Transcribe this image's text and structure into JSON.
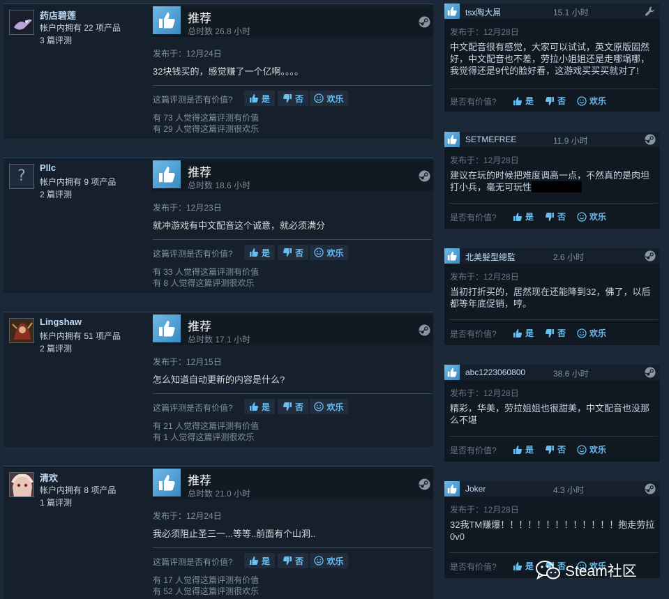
{
  "ui": {
    "recommended": "推荐",
    "posted_prefix": "发布于：",
    "helpful_question": "这篇评测是否有价值?",
    "yes": "是",
    "no": "否",
    "funny": "欢乐",
    "mini_helpful_question": "是否有价值?"
  },
  "reviews": [
    {
      "author": "药店碧莲",
      "products": "帐户内拥有 22 项产品",
      "reviews_count": "3 篇评测",
      "hours": "总时数 26.8 小时",
      "posted": "发布于：12月24日",
      "content": "32块钱买的，感觉赚了一个亿啊。。。。",
      "helpful_count": "有 73 人觉得这篇评测有价值",
      "funny_count": "有 29 人觉得这篇评测很欢乐"
    },
    {
      "author": "Pllc",
      "products": "帐户内拥有 9 项产品",
      "reviews_count": "2 篇评测",
      "hours": "总时数 18.6 小时",
      "posted": "发布于：12月23日",
      "content": "就冲游戏有中文配音这个诚意，就必须满分",
      "helpful_count": "有 33 人觉得这篇评测有价值",
      "funny_count": "有 8 人觉得这篇评测很欢乐"
    },
    {
      "author": "Lingshaw",
      "products": "帐户内拥有 51 项产品",
      "reviews_count": "2 篇评测",
      "hours": "总时数 17.1 小时",
      "posted": "发布于：12月15日",
      "content": "怎么知道自动更新的内容是什么?",
      "helpful_count": "有 21 人觉得这篇评测有价值",
      "funny_count": "有 1 人觉得这篇评测很欢乐"
    },
    {
      "author": "清欢",
      "products": "帐户内拥有 8 项产品",
      "reviews_count": "1 篇评测",
      "hours": "总时数 21.0 小时",
      "posted": "发布于：12月24日",
      "content": "我必须阻止圣三一...等等..前面有个山洞..",
      "helpful_count": "有 17 人觉得这篇评测有价值",
      "funny_count": "有 52 人觉得这篇评测很欢乐"
    }
  ],
  "mini_reviews": [
    {
      "author": "tsx陶大屌",
      "hours": "15.1 小时",
      "posted": "发布于：12月28日",
      "text": "中文配音很有感觉，大家可以试试，英文原版固然好，中文配音也不差，劳拉小姐姐还是走哪塌哪，我觉得还是9代的脸好看，这游戏买买买就对了!"
    },
    {
      "author": "SETMEFREE",
      "hours": "11.9 小时",
      "posted": "发布于：12月28日",
      "text": "建议在玩的时候把难度调高一点，不然真的是肉坦打小兵，毫无可玩性"
    },
    {
      "author": "北美髮型總監",
      "hours": "2.6 小时",
      "posted": "发布于：12月28日",
      "text": "当初打折买的，居然现在还能降到32，佛了，以后都等年底促销，哼。"
    },
    {
      "author": "abc1223060800",
      "hours": "38.6 小时",
      "posted": "发布于：12月28日",
      "text": "精彩，华美，劳拉姐姐也很甜美，中文配音也没那么不堪"
    },
    {
      "author": "Joker",
      "hours": "4.3 小时",
      "posted": "发布于：12月28日",
      "text": "32我TM赚爆！！！！！！！！！！！！！抱走劳拉0v0"
    }
  ],
  "watermark": {
    "text": "Steam社区",
    "icon": "wechat-icon"
  },
  "colors": {
    "background": "#1b2838",
    "panel": "#16202d",
    "link": "#66c0f4",
    "thumb": "#4b9ad4"
  }
}
